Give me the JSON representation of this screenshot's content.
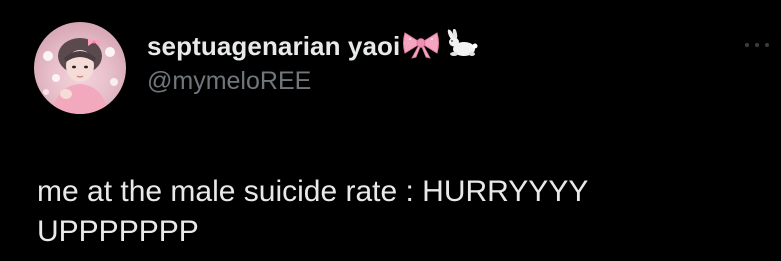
{
  "tweet": {
    "author": {
      "display_name": "septuagenarian yaoi",
      "name_emojis": [
        "ribbon-emoji",
        "rabbit-emoji"
      ],
      "handle": "@mymeloREE",
      "avatar": "profile-photo"
    },
    "menu_icon": "more-options-icon",
    "text_lines": [
      "me at the male suicide rate : HURRYYYY",
      "UPPPPPPP"
    ]
  },
  "colors": {
    "background": "#000000",
    "primary_text": "#e7e9ea",
    "secondary_text": "#71767b",
    "ribbon": "#f4a5c0"
  }
}
